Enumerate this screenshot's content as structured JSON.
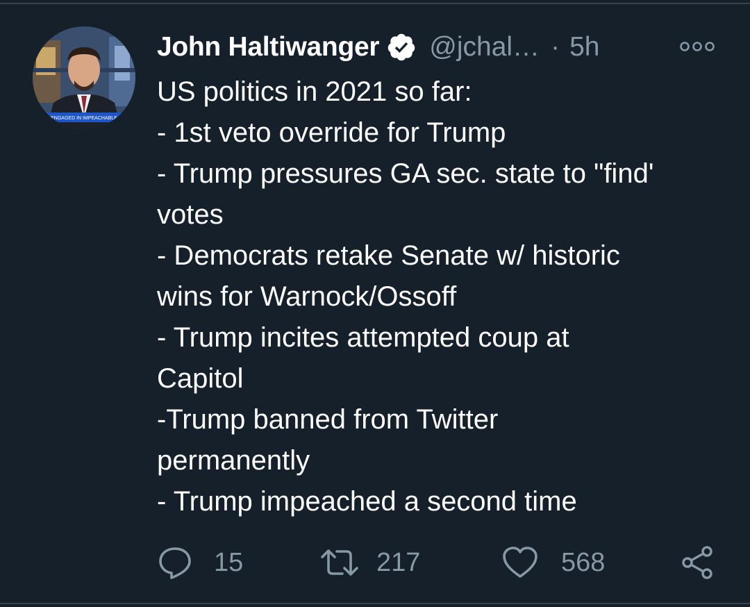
{
  "tweet": {
    "author": {
      "name": "John Haltiwanger",
      "handle": "@jchal…",
      "verified": true
    },
    "separator": "·",
    "timestamp": "5h",
    "avatar_caption": "ENGAGED IN IMPEACHABLE",
    "lines": [
      "US politics in 2021 so far:",
      "- 1st veto override for Trump",
      "- Trump pressures GA sec. state to \"find'",
      "votes",
      "- Democrats retake Senate w/ historic",
      "wins for Warnock/Ossoff",
      "- Trump incites attempted coup at",
      "Capitol",
      "-Trump banned from Twitter",
      "permanently",
      "- Trump impeached a second time"
    ],
    "stats": {
      "replies": "15",
      "retweets": "217",
      "likes": "568"
    }
  },
  "colors": {
    "background": "#15202b",
    "text_primary": "#ffffff",
    "text_secondary": "#8899a6",
    "divider": "#38444d"
  },
  "icons": {
    "verified": "verified-badge-icon",
    "more": "more-options-icon",
    "reply": "reply-icon",
    "retweet": "retweet-icon",
    "like": "heart-icon",
    "share": "share-icon"
  }
}
